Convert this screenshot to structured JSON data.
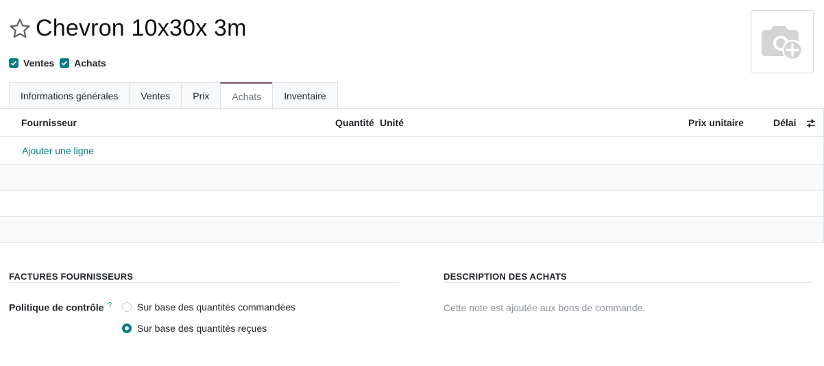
{
  "product": {
    "title": "Chevron 10x30x 3m",
    "checkboxes": [
      {
        "label": "Ventes",
        "checked": true
      },
      {
        "label": "Achats",
        "checked": true
      }
    ],
    "image_icon": "camera-plus-icon"
  },
  "tabs": [
    {
      "label": "Informations générales",
      "active": false
    },
    {
      "label": "Ventes",
      "active": false
    },
    {
      "label": "Prix",
      "active": false
    },
    {
      "label": "Achats",
      "active": true
    },
    {
      "label": "Inventaire",
      "active": false
    }
  ],
  "table": {
    "columns": [
      "Fournisseur",
      "Quantité",
      "Unité",
      "Prix unitaire",
      "Délai"
    ],
    "add_line": "Ajouter une ligne",
    "settings_icon": "column-settings-icon"
  },
  "vendor_bills": {
    "section_title": "FACTURES FOURNISSEURS",
    "control_policy_label": "Politique de contrôle",
    "help_mark": "?",
    "options": [
      {
        "label": "Sur base des quantités commandées",
        "selected": false
      },
      {
        "label": "Sur base des quantités reçues",
        "selected": true
      }
    ]
  },
  "purchase_description": {
    "section_title": "DESCRIPTION DES ACHATS",
    "placeholder": "Cette note est ajoutée aux bons de commande."
  },
  "colors": {
    "accent": "#017e84",
    "tab_active_border": "#714b67"
  }
}
